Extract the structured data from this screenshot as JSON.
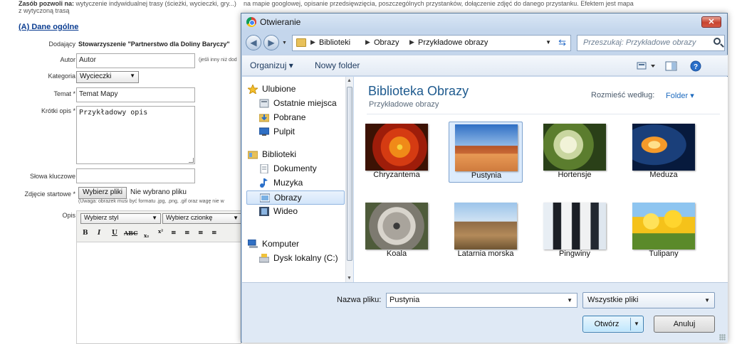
{
  "form": {
    "intro_bold": "Zasób pozwoli na:",
    "intro_text": " wytyczenie indywidualnej trasy (ścieżki, wycieczki, gry...)",
    "intro_line2": "z wytyczoną trasą",
    "intro_right": "na mapie googlowej, opisanie  przedsięwzięcia,  poszczególnych przystanków, dołączenie zdjęć do danego przystanku.  Efektem jest mapa",
    "section_title": "(A) Dane ogólne",
    "labels": {
      "dodajacy": "Dodający",
      "autor": "Autor",
      "kategoria": "Kategoria",
      "temat": "Temat *",
      "opis_krotki": "Krótki opis *",
      "slowa": "Słowa kluczowe",
      "zdjecie": "Zdjęcie startowe *",
      "opis": "Opis"
    },
    "dodajacy_value": "Stowarzyszenie \"Partnerstwo dla Doliny Baryczy\"",
    "autor_value": "Autor",
    "autor_note": "(jeśli inny niż dod",
    "kategoria_value": "Wycieczki",
    "temat_value": "Temat Mapy",
    "krotki_opis_value": "Przykładowy opis",
    "file_button": "Wybierz pliki",
    "file_status": "Nie wybrano pliku",
    "file_note": "(Uwaga: obrazek musi być formatu .jpg, .png, .gif oraz wagę nie w",
    "style_select": "Wybierz styl",
    "font_select": "Wybierz czionkę",
    "toolbar": [
      "B",
      "I",
      "U",
      "ABC",
      "x₂",
      "x²",
      "≡",
      "≡",
      "≡",
      "≡"
    ]
  },
  "dialog": {
    "title": "Otwieranie",
    "close_label": "✕",
    "breadcrumb": [
      "Biblioteki",
      "Obrazy",
      "Przykładowe obrazy"
    ],
    "search_placeholder": "Przeszukaj: Przykładowe obrazy",
    "organize": "Organizuj ▾",
    "new_folder": "Nowy folder",
    "nav": [
      {
        "label": "Ulubione",
        "icon": "star-icon",
        "child": false
      },
      {
        "label": "Ostatnie miejsca",
        "icon": "recent-places-icon",
        "child": true
      },
      {
        "label": "Pobrane",
        "icon": "downloads-icon",
        "child": true
      },
      {
        "label": "Pulpit",
        "icon": "desktop-icon",
        "child": true
      },
      {
        "label": "Biblioteki",
        "icon": "libraries-icon",
        "child": false
      },
      {
        "label": "Dokumenty",
        "icon": "documents-icon",
        "child": true
      },
      {
        "label": "Muzyka",
        "icon": "music-icon",
        "child": true
      },
      {
        "label": "Obrazy",
        "icon": "pictures-icon",
        "child": true,
        "selected": true
      },
      {
        "label": "Wideo",
        "icon": "video-icon",
        "child": true
      },
      {
        "label": "Komputer",
        "icon": "computer-icon",
        "child": false
      },
      {
        "label": "Dysk lokalny (C:)",
        "icon": "drive-icon",
        "child": true
      }
    ],
    "library_title": "Biblioteka Obrazy",
    "library_subtitle": "Przykładowe obrazy",
    "arrange_label": "Rozmieść według:",
    "arrange_value": "Folder ▾",
    "files": [
      {
        "name": "Chryzantema",
        "thumb": "chrysanthemum"
      },
      {
        "name": "Pustynia",
        "thumb": "desert",
        "selected": true
      },
      {
        "name": "Hortensje",
        "thumb": "hydrangeas"
      },
      {
        "name": "Meduza",
        "thumb": "jellyfish"
      },
      {
        "name": "Koala",
        "thumb": "koala"
      },
      {
        "name": "Latarnia morska",
        "thumb": "lighthouse"
      },
      {
        "name": "Pingwiny",
        "thumb": "penguins"
      },
      {
        "name": "Tulipany",
        "thumb": "tulips"
      }
    ],
    "filename_label": "Nazwa pliku:",
    "filename_value": "Pustynia",
    "filetype_value": "Wszystkie pliki",
    "open_button": "Otwórz",
    "cancel_button": "Anuluj"
  }
}
